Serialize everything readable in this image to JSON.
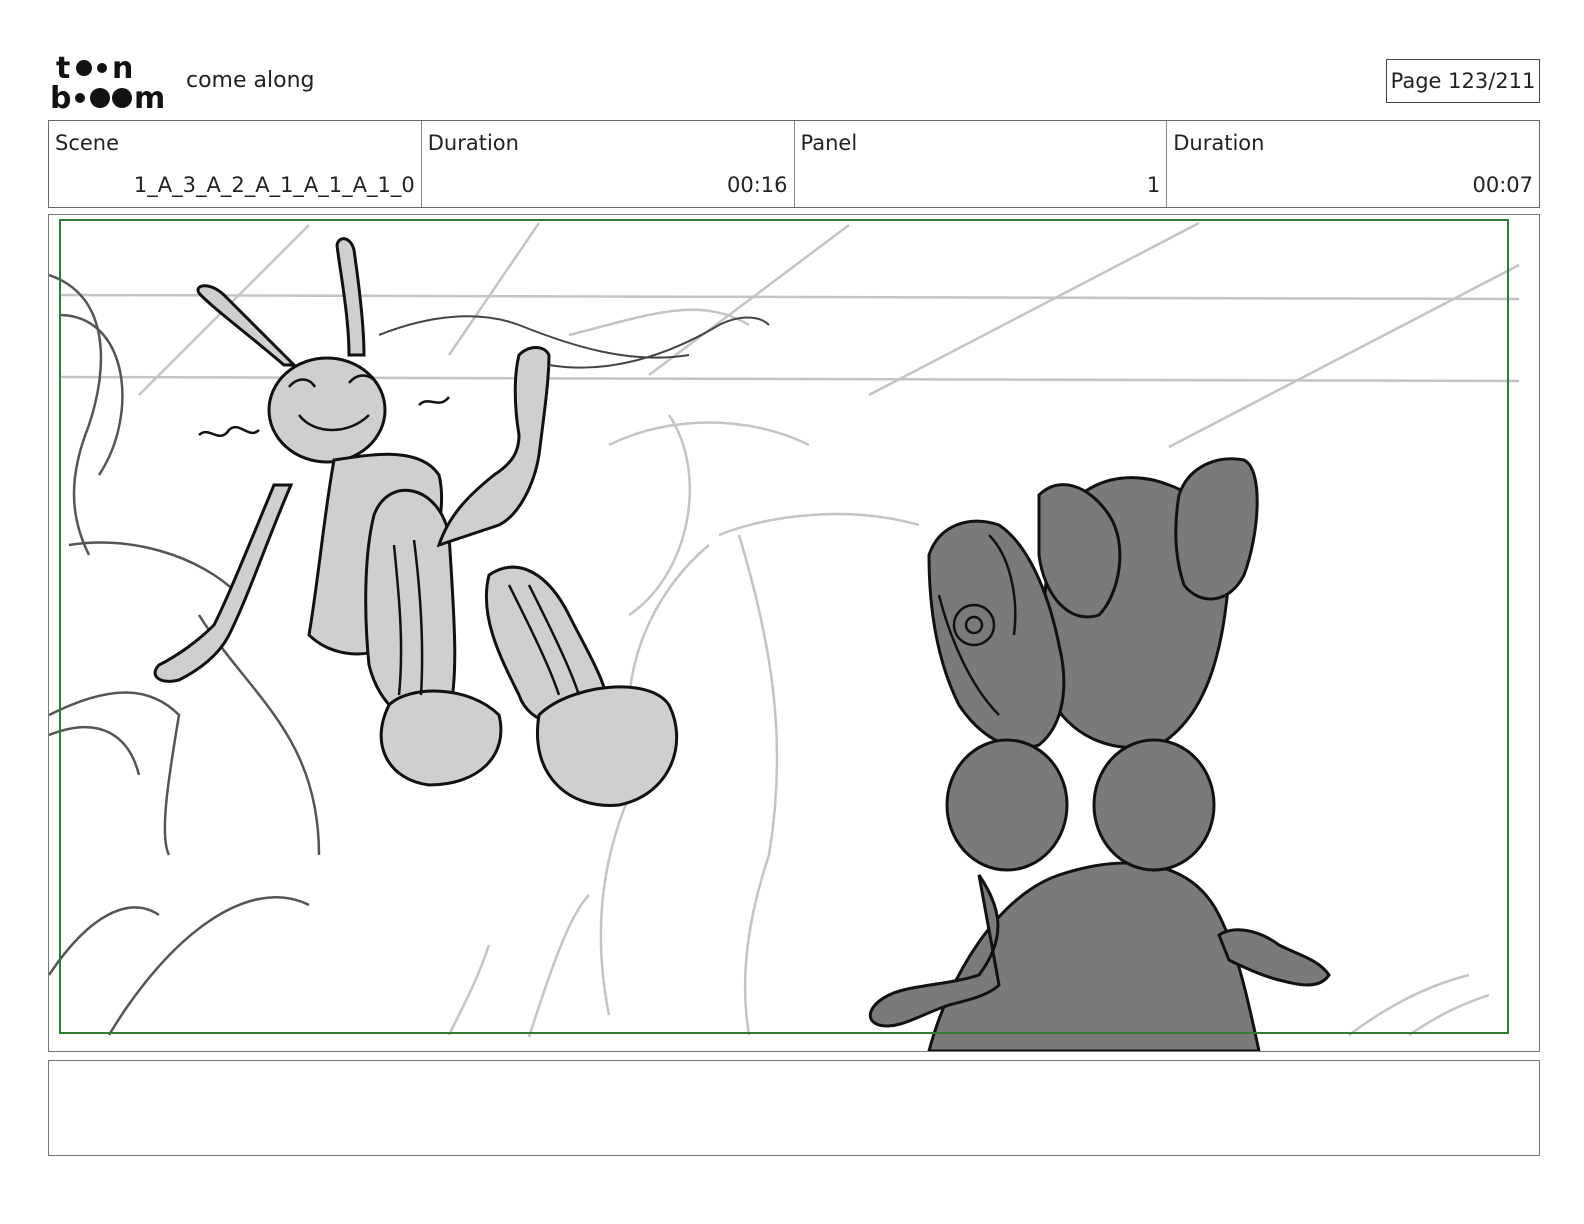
{
  "header": {
    "project_title": "come along",
    "page_label": "Page 123/211"
  },
  "info": {
    "scene_label": "Scene",
    "scene_value": "1_A_3_A_2_A_1_A_1_A_1_0",
    "scene_duration_label": "Duration",
    "scene_duration_value": "00:16",
    "panel_label": "Panel",
    "panel_value": "1",
    "panel_duration_label": "Duration",
    "panel_duration_value": "00:07"
  },
  "colors": {
    "safe_frame": "#2e7d32",
    "rabbit_fill": "#cfcfcf",
    "creature_fill": "#7a7a7a",
    "sketch_line": "#bdbdbd"
  },
  "notes": {
    "text": ""
  }
}
